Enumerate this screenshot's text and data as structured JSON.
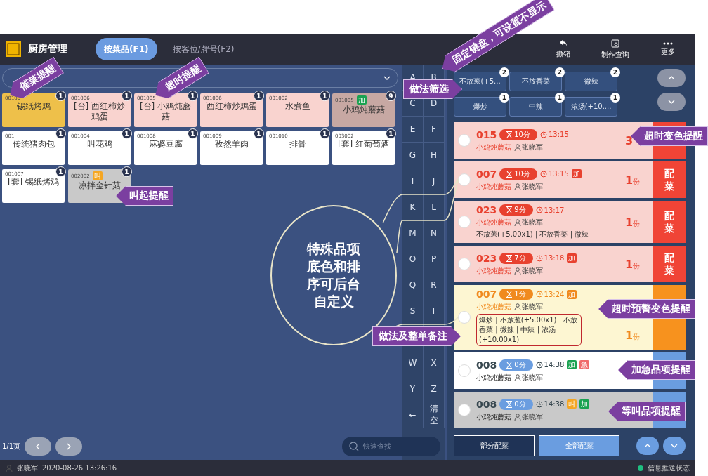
{
  "header": {
    "title": "厨房管理",
    "tabs": [
      {
        "label": "按菜品(F1)",
        "selected": true
      },
      {
        "label": "按客位/牌号(F2)",
        "selected": false
      }
    ],
    "actions": [
      "撤销",
      "制作查询",
      "更多"
    ]
  },
  "dishes": [
    {
      "code": "00100",
      "name": "锡纸烤鸡",
      "count": "1",
      "kind": "urged"
    },
    {
      "code": "001006",
      "name": "[台] 西红柿炒鸡蛋",
      "count": "1",
      "kind": "overtime"
    },
    {
      "code": "001005",
      "name": "[台] 小鸡炖蘑菇",
      "count": "1",
      "kind": "overtime"
    },
    {
      "code": "001006",
      "name": "西红柿炒鸡蛋",
      "count": "1",
      "kind": "overtime"
    },
    {
      "code": "001002",
      "name": "水煮鱼",
      "count": "1",
      "kind": "overtime"
    },
    {
      "code": "001005",
      "name": "小鸡炖蘑菇",
      "count": "9",
      "kind": "special",
      "tags": [
        {
          "label": "加",
          "color": "#1aa251"
        }
      ]
    },
    {
      "code": "001",
      "name": "传统猪肉包",
      "count": "1",
      "kind": "normal"
    },
    {
      "code": "001004",
      "name": "叫花鸡",
      "count": "1",
      "kind": "normal"
    },
    {
      "code": "001008",
      "name": "麻婆豆腐",
      "count": "1",
      "kind": "normal"
    },
    {
      "code": "001009",
      "name": "孜然羊肉",
      "count": "1",
      "kind": "normal"
    },
    {
      "code": "001010",
      "name": "排骨",
      "count": "1",
      "kind": "normal"
    },
    {
      "code": "003002",
      "name": "[套] 红葡萄酒",
      "count": "1",
      "kind": "normal"
    },
    {
      "code": "001007",
      "name": "[套] 锡纸烤鸡",
      "count": "1",
      "kind": "normal"
    },
    {
      "code": "002002",
      "name": "凉拌金针菇",
      "count": "1",
      "kind": "called",
      "tags": [
        {
          "label": "叫",
          "color": "#f5a623"
        }
      ]
    }
  ],
  "pagination": {
    "page": "1/1页"
  },
  "search": {
    "placeholder": "快速查找"
  },
  "keyboard": [
    {
      "keys": [
        "A",
        "B"
      ]
    },
    {
      "keys": [
        "C",
        "D"
      ]
    },
    {
      "keys": [
        "E",
        "F"
      ]
    },
    {
      "keys": [
        "G",
        "H"
      ]
    },
    {
      "keys": [
        "I",
        "J"
      ]
    },
    {
      "keys": [
        "K",
        "L"
      ]
    },
    {
      "keys": [
        "M",
        "N"
      ]
    },
    {
      "keys": [
        "O",
        "P"
      ]
    },
    {
      "keys": [
        "Q",
        "R"
      ]
    },
    {
      "keys": [
        "S",
        "T"
      ]
    },
    {
      "covered": true
    },
    {
      "keys": [
        "W",
        "X"
      ]
    },
    {
      "keys": [
        "Y",
        "Z"
      ]
    },
    {
      "keys": [
        "←",
        "清空"
      ]
    }
  ],
  "filters": [
    {
      "label": "不放葱(+5...",
      "count": "2"
    },
    {
      "label": "不放香菜",
      "count": "2"
    },
    {
      "label": "微辣",
      "count": "2"
    },
    {
      "label": "爆炒",
      "count": "1"
    },
    {
      "label": "中辣",
      "count": "1"
    },
    {
      "label": "浓汤(+10....",
      "count": "1"
    }
  ],
  "orders": [
    {
      "checked": false,
      "number": "015",
      "wait": "10分",
      "time": "13:15",
      "kind": "overtime",
      "name": "小鸡炖蘑菇",
      "staff": "张晓军",
      "qty": "3"
    },
    {
      "checked": false,
      "number": "007",
      "wait": "10分",
      "time": "13:15",
      "kind": "overtime",
      "tags": [
        {
          "label": "加",
          "color": "#e8412f"
        }
      ],
      "name": "小鸡炖蘑菇",
      "staff": "张晓军",
      "qty": "1",
      "unit": "份",
      "action": "配菜"
    },
    {
      "checked": false,
      "number": "023",
      "wait": "9分",
      "time": "13:17",
      "kind": "overtime",
      "name": "小鸡炖蘑菇",
      "staff": "张晓军",
      "notes": "不放葱(+5.00x1) | 不放香菜 | 微辣",
      "qty": "1",
      "unit": "份",
      "action": "配菜"
    },
    {
      "checked": false,
      "number": "023",
      "wait": "7分",
      "time": "13:18",
      "kind": "overtime",
      "tags": [
        {
          "label": "加",
          "color": "#e8412f"
        }
      ],
      "name": "小鸡炖蘑菇",
      "staff": "张晓军",
      "qty": "1",
      "unit": "份",
      "action": "配菜"
    },
    {
      "checked": false,
      "number": "007",
      "wait": "1分",
      "time": "13:24",
      "kind": "warning",
      "tags": [
        {
          "label": "加",
          "color": "#f08a1e"
        }
      ],
      "name": "小鸡炖蘑菇",
      "staff": "张晓军",
      "notes": "爆炒 | 不放葱(+5.00x1) | 不放香菜 | 微辣 | 中辣 | 浓汤(+10.00x1)",
      "notes_highlighted": true,
      "qty": "1",
      "unit": "份"
    },
    {
      "checked": false,
      "number": "008",
      "wait": "0分",
      "time": "14:38",
      "kind": "normal",
      "tags": [
        {
          "label": "加",
          "color": "#1aa251"
        },
        {
          "label": "急",
          "color": "#f06a6a"
        }
      ],
      "name": "小鸡炖蘑菇",
      "staff": "张晓军"
    },
    {
      "checked": false,
      "number": "008",
      "wait": "0分",
      "time": "14:38",
      "kind": "waiting",
      "tags": [
        {
          "label": "叫",
          "color": "#f5a623"
        },
        {
          "label": "加",
          "color": "#1aa251"
        }
      ],
      "name": "小鸡炖蘑菇",
      "staff": "张晓军"
    }
  ],
  "confirm": [
    {
      "label": "部分配菜",
      "selected": false
    },
    {
      "label": "全部配菜",
      "selected": true
    }
  ],
  "status": {
    "user": "张晓军",
    "time": "2020-08-26 13:26:16",
    "push": "信息推送状态",
    "online": true
  },
  "annotations": [
    "催菜提醒",
    "超时提醒",
    "叫起提醒",
    "固定键盘，可设置不显示",
    "做法筛选",
    "超时变色提醒",
    "超时预警变色提醒",
    "做法及整单备注",
    "加急品项提醒",
    "等叫品项提醒"
  ],
  "bubble": {
    "text": "特殊品项底色和排序可后台自定义"
  }
}
